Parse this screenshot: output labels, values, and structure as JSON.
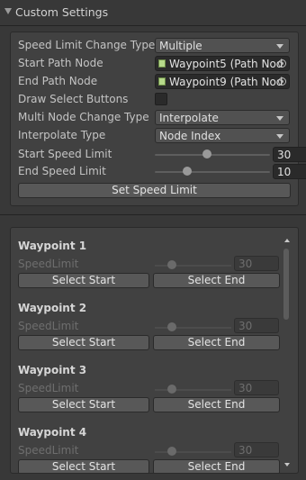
{
  "header": {
    "title": "Custom Settings"
  },
  "settings": {
    "speed_limit_change_type": {
      "label": "Speed Limit Change Type",
      "value": "Multiple"
    },
    "start_path_node": {
      "label": "Start Path Node",
      "value": "Waypoint5 (Path Nod"
    },
    "end_path_node": {
      "label": "End Path Node",
      "value": "Waypoint9 (Path Nod"
    },
    "draw_select_buttons": {
      "label": "Draw Select Buttons",
      "checked": false
    },
    "multi_node_change_type": {
      "label": "Multi Node Change Type",
      "value": "Interpolate"
    },
    "interpolate_type": {
      "label": "Interpolate Type",
      "value": "Node Index"
    },
    "start_speed_limit": {
      "label": "Start Speed Limit",
      "value": "30",
      "fraction": 0.45
    },
    "end_speed_limit": {
      "label": "End Speed Limit",
      "value": "10",
      "fraction": 0.28
    },
    "set_speed_limit_button": "Set Speed Limit"
  },
  "waypoints": [
    {
      "title": "Waypoint 1",
      "field_label": "SpeedLimit",
      "value": "30",
      "select_start": "Select Start",
      "select_end": "Select End"
    },
    {
      "title": "Waypoint 2",
      "field_label": "SpeedLimit",
      "value": "30",
      "select_start": "Select Start",
      "select_end": "Select End"
    },
    {
      "title": "Waypoint 3",
      "field_label": "SpeedLimit",
      "value": "30",
      "select_start": "Select Start",
      "select_end": "Select End"
    },
    {
      "title": "Waypoint 4",
      "field_label": "SpeedLimit",
      "value": "30",
      "select_start": "Select Start",
      "select_end": "Select End"
    }
  ],
  "icons": {
    "foldout": "triangle-down-icon",
    "object_field": "script-icon",
    "object_picker": "target-icon",
    "dropdown": "chevron-down-icon",
    "scroll_up": "arrow-up-icon",
    "scroll_down": "arrow-down-icon"
  },
  "colors": {
    "background": "#383838",
    "panel": "#414141",
    "field": "#2a2a2a",
    "button": "#585858",
    "text": "#c4c4c4"
  }
}
